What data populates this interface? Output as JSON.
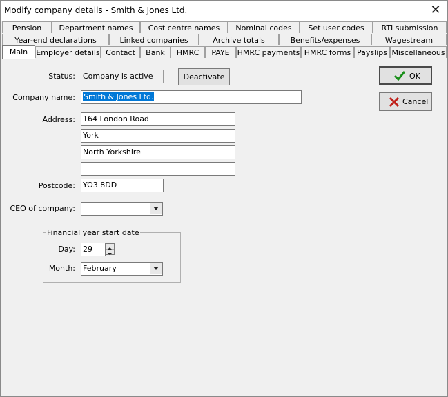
{
  "window": {
    "title": "Modify company details - Smith & Jones Ltd.",
    "close_glyph": "✕"
  },
  "tabs": {
    "row1": [
      "Pension",
      "Department names",
      "Cost centre names",
      "Nominal codes",
      "Set user codes",
      "RTI submission"
    ],
    "row2": [
      "Year-end declarations",
      "Linked companies",
      "Archive totals",
      "Benefits/expenses",
      "Wagestream"
    ],
    "row3": [
      "Main",
      "Employer details",
      "Contact",
      "Bank",
      "HMRC",
      "PAYE",
      "HMRC payments",
      "HMRC forms",
      "Payslips",
      "Miscellaneous"
    ],
    "active": "Main"
  },
  "status": {
    "label": "Status:",
    "value": "Company is active",
    "deactivate_label": "Deactivate"
  },
  "company_name": {
    "label": "Company name:",
    "value": "Smith & Jones Ltd."
  },
  "address": {
    "label": "Address:",
    "lines": [
      "164 London Road",
      "York",
      "North Yorkshire",
      ""
    ]
  },
  "postcode": {
    "label": "Postcode:",
    "value": "YO3 8DD"
  },
  "ceo": {
    "label": "CEO of company:",
    "value": ""
  },
  "financial_year": {
    "title": "Financial year start date",
    "day_label": "Day:",
    "day_value": "29",
    "month_label": "Month:",
    "month_value": "February"
  },
  "buttons": {
    "ok_label": "OK",
    "cancel_label": "Cancel"
  },
  "colors": {
    "selection": "#0078d7",
    "ok_check": "#1a8f1a",
    "cancel_x": "#c0201a"
  },
  "icons": {
    "ok": "check-icon",
    "cancel": "x-icon",
    "dropdown": "chevron-down-icon",
    "spin": "spin-arrows-icon"
  }
}
